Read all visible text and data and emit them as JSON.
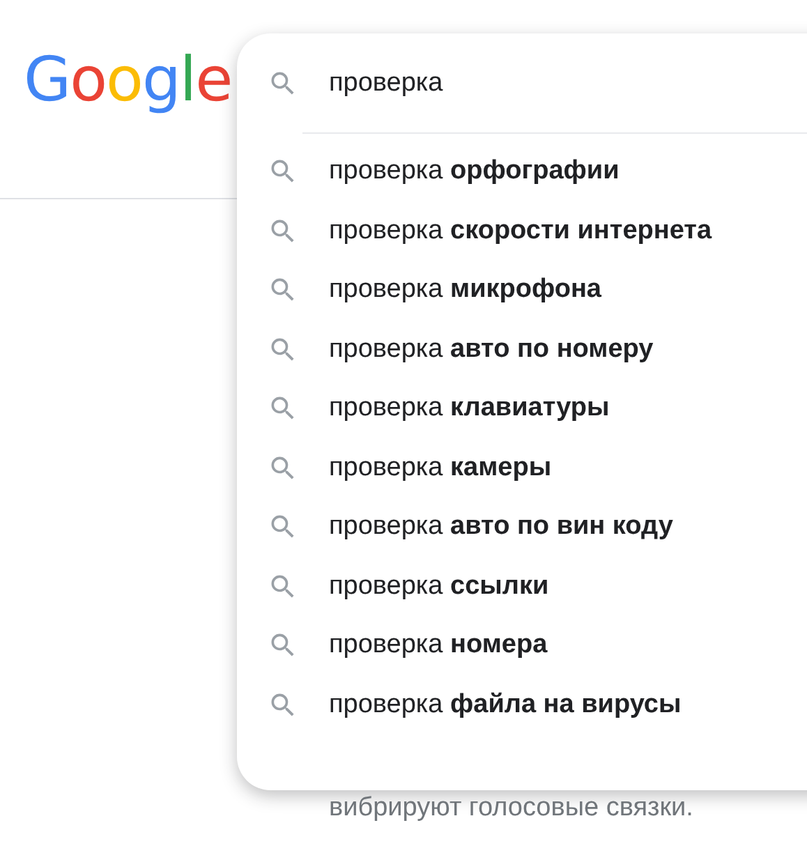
{
  "logo": "Google",
  "search": {
    "value": "проверка"
  },
  "suggestions": [
    "проверка **орфографии**",
    "проверка **скорости интернета**",
    "проверка **микрофона**",
    "проверка **авто по номеру**",
    "проверка **клавиатуры**",
    "проверка **камеры**",
    "проверка **авто по вин коду**",
    "проверка **ссылки**",
    "проверка **номера**",
    "проверка **файла на вирусы**"
  ],
  "snippet": "вибрируют голосовые связки."
}
